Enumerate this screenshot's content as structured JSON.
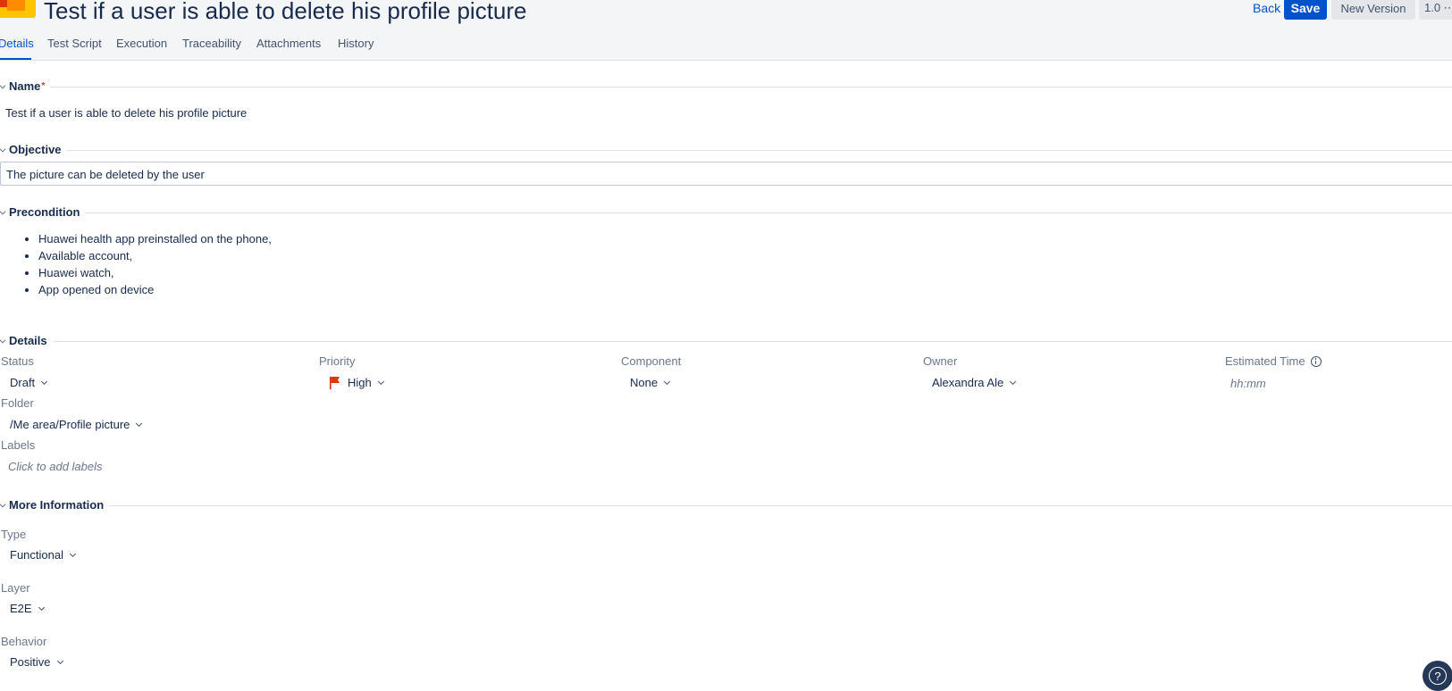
{
  "header": {
    "title": "Test if a user is able to delete his profile picture",
    "back_label": "Back",
    "save_label": "Save",
    "new_version_label": "New Version",
    "version_label": "1.0 ⋯"
  },
  "tabs": [
    {
      "label": "Details",
      "active": true
    },
    {
      "label": "Test Script"
    },
    {
      "label": "Execution"
    },
    {
      "label": "Traceability"
    },
    {
      "label": "Attachments"
    },
    {
      "label": "History"
    }
  ],
  "sections": {
    "name": {
      "title": "Name",
      "required_mark": "*",
      "value": "Test if a user is able to delete his profile picture"
    },
    "objective": {
      "title": "Objective",
      "value": "The picture can be deleted by the user"
    },
    "precondition": {
      "title": "Precondition",
      "items": [
        "Huawei health app preinstalled on the phone,",
        "Available account,",
        "Huawei watch,",
        "App opened on device"
      ]
    },
    "details": {
      "title": "Details",
      "status": {
        "label": "Status",
        "value": "Draft"
      },
      "priority": {
        "label": "Priority",
        "value": "High"
      },
      "component": {
        "label": "Component",
        "value": "None"
      },
      "owner": {
        "label": "Owner",
        "value": "Alexandra Ale"
      },
      "estimated_time": {
        "label": "Estimated Time",
        "placeholder": "hh:mm"
      },
      "folder": {
        "label": "Folder",
        "value": "/Me area/Profile picture"
      },
      "labels": {
        "label": "Labels",
        "placeholder": "Click to add labels"
      }
    },
    "more_info": {
      "title": "More Information",
      "type": {
        "label": "Type",
        "value": "Functional"
      },
      "layer": {
        "label": "Layer",
        "value": "E2E"
      },
      "behavior": {
        "label": "Behavior",
        "value": "Positive"
      }
    }
  },
  "help_label": "?",
  "colors": {
    "accent": "#0052cc",
    "flag": "#de350b",
    "logo_yellow": "#ffc400",
    "logo_red": "#de350b"
  }
}
